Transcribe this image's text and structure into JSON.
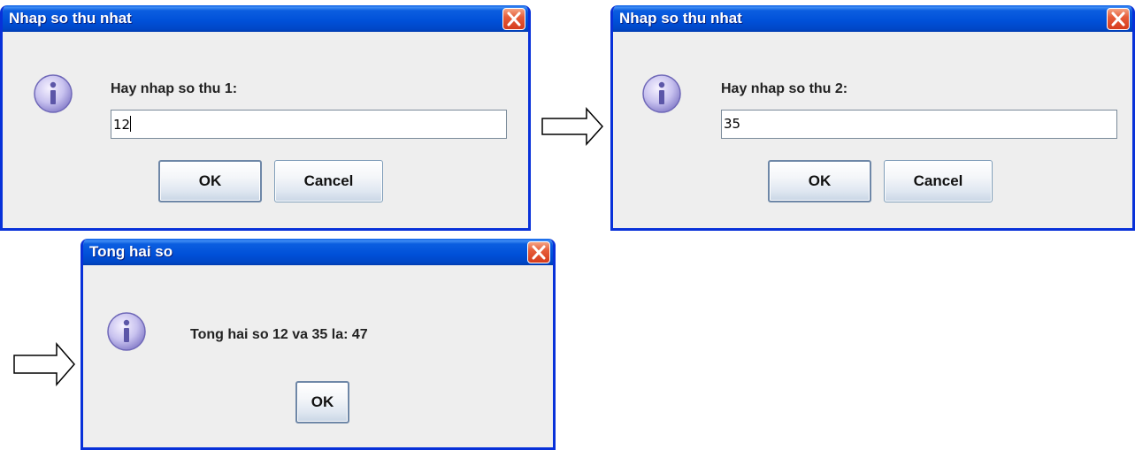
{
  "dialog1": {
    "title": "Nhap so thu nhat",
    "prompt": "Hay nhap so thu 1:",
    "input_value": "12",
    "ok_label": "OK",
    "cancel_label": "Cancel"
  },
  "dialog2": {
    "title": "Nhap so thu nhat",
    "prompt": "Hay nhap so thu 2:",
    "input_value": "35",
    "ok_label": "OK",
    "cancel_label": "Cancel"
  },
  "dialog3": {
    "title": "Tong hai so",
    "message": "Tong hai so 12 va 35 la: 47",
    "ok_label": "OK"
  },
  "icons": {
    "info": "info-icon",
    "close": "close-icon",
    "arrow": "arrow-right-icon"
  },
  "colors": {
    "titlebar": "#0050d8",
    "frame": "#0831d9",
    "close_button": "#e65d3a",
    "dialog_body": "#eeeeee"
  }
}
